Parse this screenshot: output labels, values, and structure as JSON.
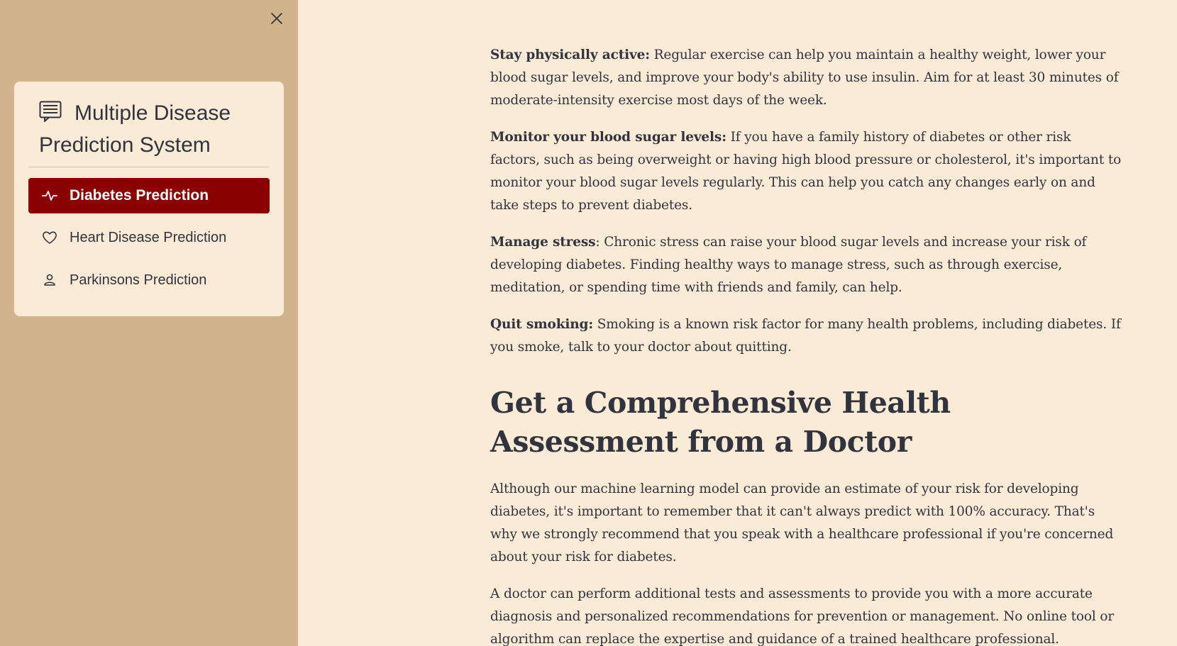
{
  "sidebar": {
    "close_icon": "close-icon",
    "header": {
      "icon": "list-icon",
      "title": "Multiple Disease Prediction System"
    },
    "items": [
      {
        "label": "Diabetes Prediction",
        "icon": "activity-icon",
        "active": true
      },
      {
        "label": "Heart Disease Prediction",
        "icon": "heart-icon",
        "active": false
      },
      {
        "label": "Parkinsons Prediction",
        "icon": "person-icon",
        "active": false
      }
    ]
  },
  "colors": {
    "sidebar_bg": "#D2B48C",
    "page_bg": "#FAEBD7",
    "active_item": "#8B0000",
    "text": "#31333F"
  },
  "main": {
    "tips": [
      {
        "title": "Stay physically active:",
        "text": " Regular exercise can help you maintain a healthy weight, lower your blood sugar levels, and improve your body's ability to use insulin. Aim for at least 30 minutes of moderate-intensity exercise most days of the week."
      },
      {
        "title": "Monitor your blood sugar levels:",
        "text": " If you have a family history of diabetes or other risk factors, such as being overweight or having high blood pressure or cholesterol, it's important to monitor your blood sugar levels regularly. This can help you catch any changes early on and take steps to prevent diabetes."
      },
      {
        "title": "Manage stress",
        "text": ": Chronic stress can raise your blood sugar levels and increase your risk of developing diabetes. Finding healthy ways to manage stress, such as through exercise, meditation, or spending time with friends and family, can help."
      },
      {
        "title": "Quit smoking:",
        "text": " Smoking is a known risk factor for many health problems, including diabetes. If you smoke, talk to your doctor about quitting."
      }
    ],
    "heading": "Get a Comprehensive Health Assessment from a Doctor",
    "paragraphs": [
      "Although our machine learning model can provide an estimate of your risk for developing diabetes, it's important to remember that it can't always predict with 100% accuracy. That's why we strongly recommend that you speak with a healthcare professional if you're concerned about your risk for diabetes.",
      "A doctor can perform additional tests and assessments to provide you with a more accurate diagnosis and personalized recommendations for prevention or management. No online tool or algorithm can replace the expertise and guidance of a trained healthcare professional."
    ]
  }
}
